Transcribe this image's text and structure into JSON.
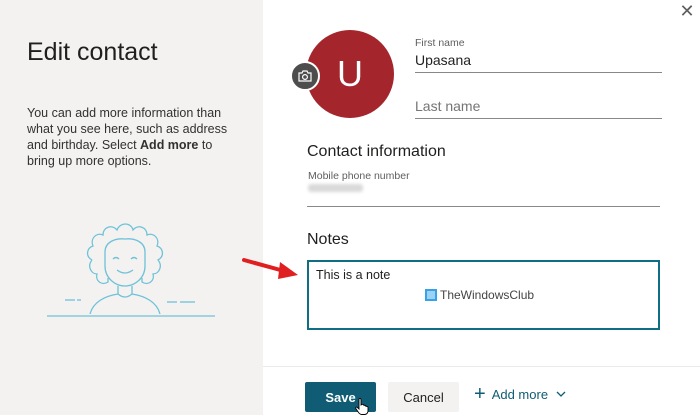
{
  "left_panel": {
    "title": "Edit contact",
    "desc_before": "You can add more information than what you see here, such as address and birthday. Select ",
    "desc_bold": "Add more",
    "desc_after": " to bring up more options."
  },
  "avatar": {
    "initial": "U",
    "color": "#a4262c"
  },
  "first_name": {
    "label": "First name",
    "value": "Upasana"
  },
  "last_name": {
    "placeholder": "Last name"
  },
  "contact_info": {
    "title": "Contact information",
    "phone_label": "Mobile phone number"
  },
  "notes": {
    "title": "Notes",
    "value": "This is a note"
  },
  "watermark": "TheWindowsClub",
  "footer": {
    "save_label": "Save",
    "cancel_label": "Cancel",
    "add_more_label": "Add more"
  },
  "icons": {
    "close": "close-icon",
    "camera": "camera-icon",
    "plus": "plus-icon",
    "chevron": "chevron-down-icon"
  },
  "colors": {
    "accent": "#0f5c74",
    "avatar": "#a4262c",
    "arrow": "#e02020"
  }
}
